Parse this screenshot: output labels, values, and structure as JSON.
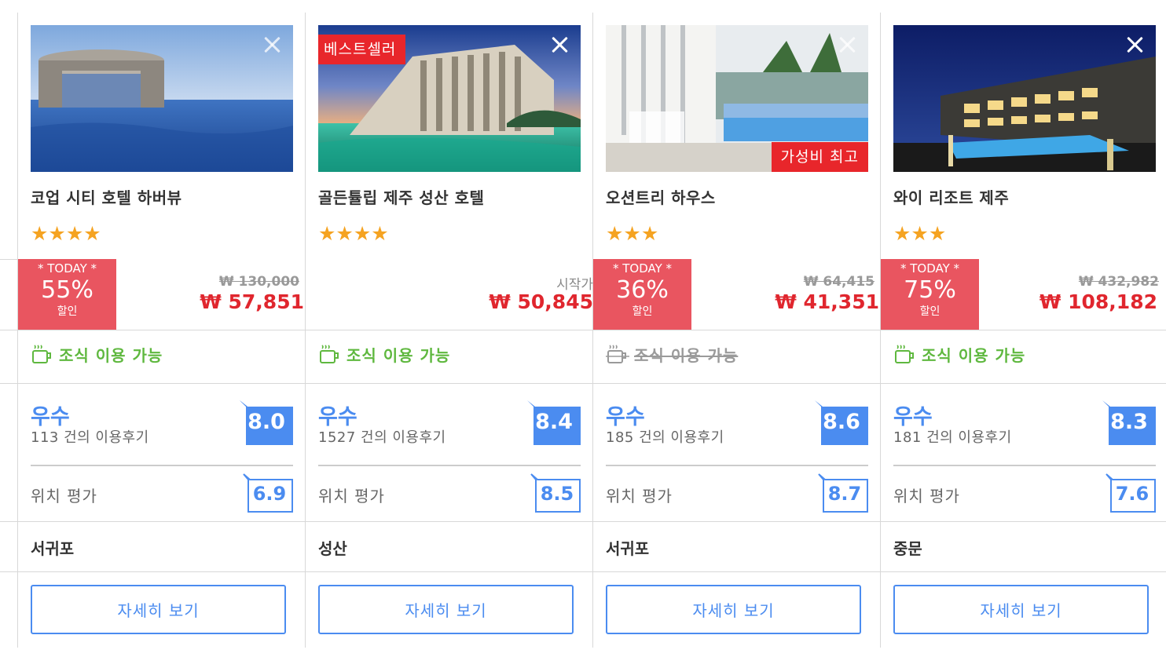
{
  "currency_symbol": "₩",
  "colors": {
    "accent": "#4b8cf0",
    "price_red": "#e0262e",
    "today_badge": "#e95560",
    "ribbon_red": "#e8262b",
    "breakfast_green": "#5fb83f",
    "star": "#f5a321"
  },
  "labels": {
    "today": "* TODAY *",
    "discount": "할인",
    "starting_from": "시작가",
    "breakfast": "조식 이용 가능",
    "location_rating": "위치 평가",
    "detail_button": "자세히 보기",
    "review_suffix": "건의 이용후기"
  },
  "hotels": [
    {
      "name": "코업 시티 호텔 하버뷰",
      "stars": "★★★★",
      "star_count": 4,
      "ribbon": null,
      "today_discount": "55%",
      "original_price": "₩ 130,000",
      "price": "₩ 57,851",
      "breakfast_available": true,
      "grade": "우수",
      "reviews": "113 건의 이용후기",
      "score": "8.0",
      "location_score": "6.9",
      "area": "서귀포",
      "image_icon": "hotel-photo-circular-building-sea"
    },
    {
      "name": "골든튤립 제주 성산 호텔",
      "stars": "★★★★",
      "star_count": 4,
      "ribbon": "베스트셀러",
      "ribbon_position": "top-left",
      "today_discount": null,
      "starting_from": "시작가",
      "price": "₩ 50,845",
      "breakfast_available": true,
      "grade": "우수",
      "reviews": "1527 건의 이용후기",
      "score": "8.4",
      "location_score": "8.5",
      "area": "성산",
      "image_icon": "hotel-photo-resort-lagoon"
    },
    {
      "name": "오션트리 하우스",
      "stars": "★★★",
      "star_count": 3,
      "ribbon": "가성비 최고",
      "ribbon_position": "bottom-right",
      "today_discount": "36%",
      "original_price": "₩ 64,415",
      "price": "₩ 41,351",
      "breakfast_available": false,
      "grade": "우수",
      "reviews": "185 건의 이용후기",
      "score": "8.6",
      "location_score": "8.7",
      "area": "서귀포",
      "image_icon": "hotel-photo-pool-palm"
    },
    {
      "name": "와이 리조트 제주",
      "stars": "★★★",
      "star_count": 3,
      "ribbon": null,
      "today_discount": "75%",
      "original_price": "₩ 432,982",
      "price": "₩ 108,182",
      "breakfast_available": true,
      "grade": "우수",
      "reviews": "181 건의 이용후기",
      "score": "8.3",
      "location_score": "7.6",
      "area": "중문",
      "image_icon": "hotel-photo-night-pool"
    }
  ]
}
